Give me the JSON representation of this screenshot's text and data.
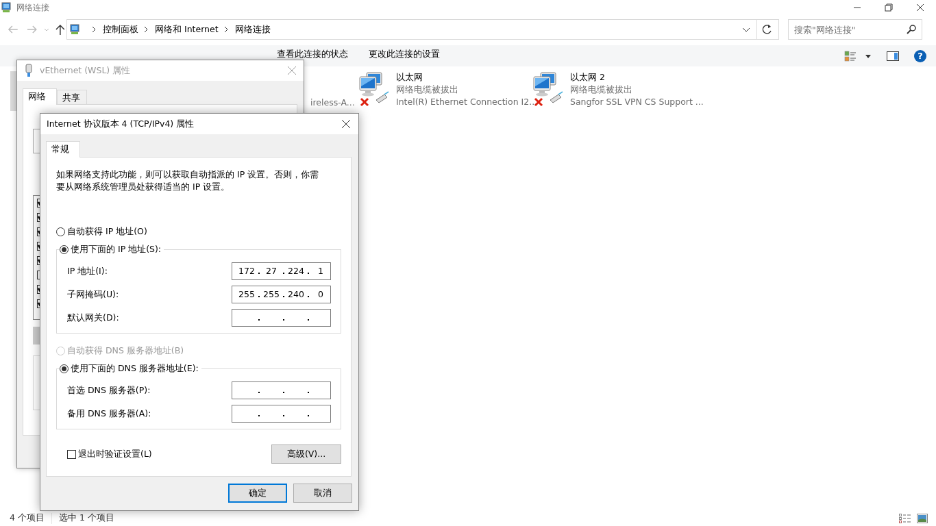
{
  "window": {
    "title": "网络连接"
  },
  "address_bar": {
    "breadcrumbs": [
      "控制面板",
      "网络和 Internet",
      "网络连接"
    ]
  },
  "search": {
    "placeholder": "搜索\"网络连接\""
  },
  "commands": [
    "查看此连接的状态",
    "更改此连接的设置"
  ],
  "help_glyph": "?",
  "connections": [
    {
      "kind": "covered",
      "selected": true
    },
    {
      "kind": "covered",
      "selected": false,
      "visible_text": "ireless-A..."
    },
    {
      "kind": "adapter",
      "selected": false,
      "name": "以太网",
      "status": "网络电缆被拔出",
      "device": "Intel(R) Ethernet Connection I2...",
      "disconnected": true
    },
    {
      "kind": "adapter",
      "selected": false,
      "name": "以太网 2",
      "status": "网络电缆被拔出",
      "device": "Sangfor SSL VPN CS Support ...",
      "disconnected": true
    }
  ],
  "status_bar": {
    "count": "4 个项目",
    "selection": "选中 1 个项目"
  },
  "back_dialog": {
    "title": "vEthernet (WSL) 属性",
    "tabs": [
      {
        "label": "网络",
        "selected": true
      },
      {
        "label": "共享",
        "selected": false
      }
    ],
    "components": [
      {
        "checked": true
      },
      {
        "checked": true
      },
      {
        "checked": true
      },
      {
        "checked": true
      },
      {
        "checked": true
      },
      {
        "checked": false
      },
      {
        "checked": true
      },
      {
        "checked": true
      }
    ]
  },
  "ipv4_dialog": {
    "title": "Internet 协议版本 4 (TCP/IPv4) 属性",
    "tabs": [
      {
        "label": "常规",
        "selected": true
      }
    ],
    "intro": "如果网络支持此功能，则可以获取自动指派的 IP 设置。否则，你需要从网络系统管理员处获得适当的 IP 设置。",
    "ip_modes": [
      {
        "label": "自动获得 IP 地址(O)",
        "selected": false,
        "disabled": false
      },
      {
        "label": "使用下面的 IP 地址(S):",
        "selected": true,
        "disabled": false
      }
    ],
    "ip_fields": [
      {
        "label": "IP 地址(I):",
        "octets": [
          "172",
          "27",
          "224",
          "1"
        ]
      },
      {
        "label": "子网掩码(U):",
        "octets": [
          "255",
          "255",
          "240",
          "0"
        ]
      },
      {
        "label": "默认网关(D):"
      }
    ],
    "dns_modes": [
      {
        "label": "自动获得 DNS 服务器地址(B)",
        "selected": false,
        "disabled": true
      },
      {
        "label": "使用下面的 DNS 服务器地址(E):",
        "selected": true,
        "disabled": false
      }
    ],
    "dns_fields": [
      {
        "label": "首选 DNS 服务器(P):"
      },
      {
        "label": "备用 DNS 服务器(A):"
      }
    ],
    "validate": {
      "label": "退出时验证设置(L)",
      "checked": false
    },
    "advanced_button": "高级(V)...",
    "buttons": [
      {
        "label": "确定",
        "default": true
      },
      {
        "label": "取消",
        "default": false
      }
    ]
  }
}
